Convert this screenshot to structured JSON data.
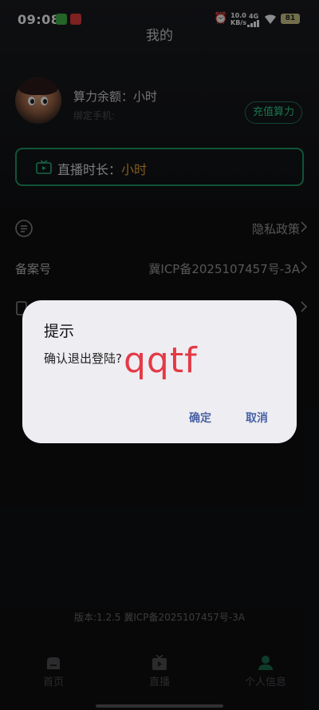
{
  "status_bar": {
    "time": "09:08",
    "net_speed_value": "10.0",
    "net_speed_unit": "KB/s",
    "network": "4G",
    "battery": "81"
  },
  "page": {
    "title": "我的"
  },
  "profile": {
    "balance_label": "算力余额：小时",
    "bind_phone_label": "绑定手机:",
    "recharge_button": "充值算力"
  },
  "live": {
    "label": "直播时长：",
    "value": "小时"
  },
  "rows": {
    "privacy": "隐私政策",
    "icp_label": "备案号",
    "icp_value": "冀ICP备2025107457号-3A"
  },
  "dialog": {
    "title": "提示",
    "message": "确认退出登陆?",
    "confirm": "确定",
    "cancel": "取消",
    "watermark": "qqtf"
  },
  "footer": {
    "version": "版本:1.2.5   冀ICP备2025107457号-3A"
  },
  "tabs": [
    {
      "label": "首页",
      "icon": "home-icon"
    },
    {
      "label": "直播",
      "icon": "tv-icon"
    },
    {
      "label": "个人信息",
      "icon": "person-icon"
    }
  ],
  "colors": {
    "accent_green": "#1f9a68",
    "accent_orange": "#f0a53a",
    "dialog_button": "#4a63a5",
    "watermark_red": "#e33a45"
  }
}
